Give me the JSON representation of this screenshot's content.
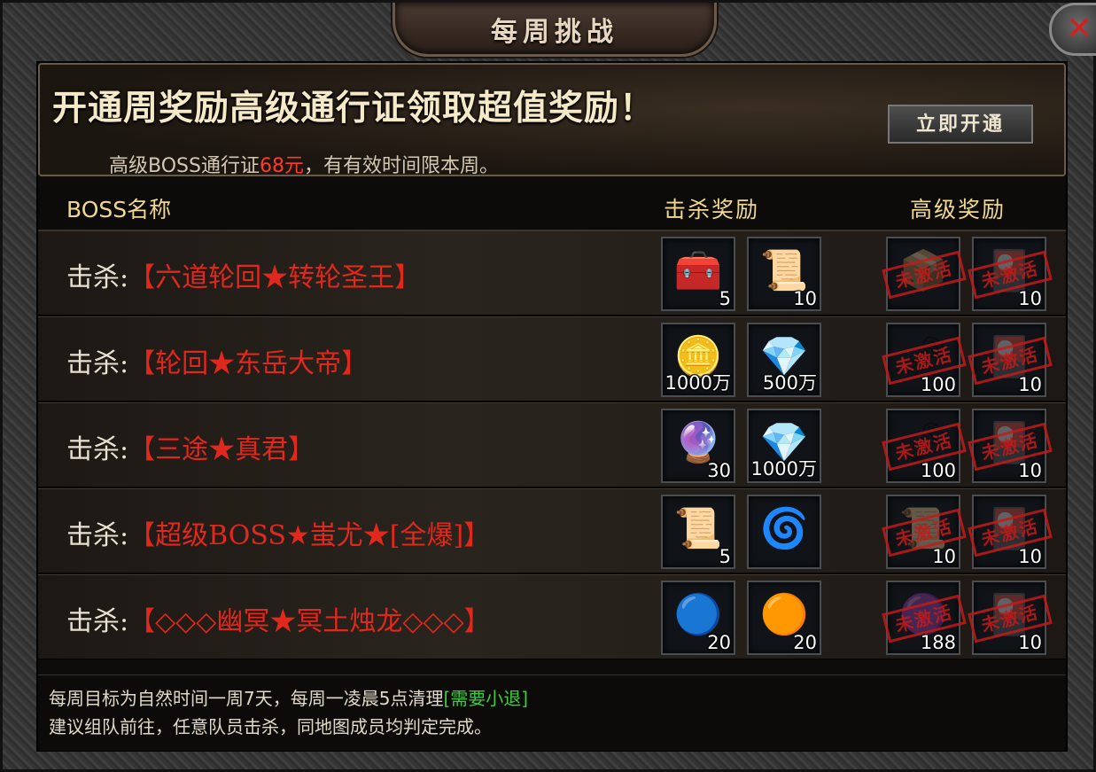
{
  "window": {
    "title": "每周挑战",
    "close_glyph": "✕"
  },
  "banner": {
    "title": "开通周奖励高级通行证领取超值奖励！",
    "sub_prefix": "高级BOSS通行证",
    "sub_price": "68元",
    "sub_suffix": "，有有效时间限本周。",
    "open_button": "立即开通"
  },
  "table": {
    "col_name": "BOSS名称",
    "col_kill": "击杀奖励",
    "col_advanced": "高级奖励",
    "kill_prefix": "击杀",
    "colon": ":",
    "locked_stamp": "未激活",
    "rows": [
      {
        "boss": "【六道轮回★转轮圣王】",
        "kill_rewards": [
          {
            "icon": "treasure-chest-icon",
            "glyph": "🧰",
            "count": "5"
          },
          {
            "icon": "scroll-map-icon",
            "glyph": "📜",
            "count": "10"
          }
        ],
        "adv_rewards": [
          {
            "icon": "golden-chest-icon",
            "glyph": "📦",
            "count": ""
          },
          {
            "icon": "red-item-icon",
            "glyph": "🎴",
            "count": "10"
          }
        ]
      },
      {
        "boss": "【轮回★东岳大帝】",
        "kill_rewards": [
          {
            "icon": "gold-ingot-icon",
            "glyph": "🪙",
            "count": "1000万"
          },
          {
            "icon": "gem-icon",
            "glyph": "💎",
            "count": "500万"
          }
        ],
        "adv_rewards": [
          {
            "icon": "dark-item-icon",
            "glyph": "🗝",
            "count": "100"
          },
          {
            "icon": "red-item-icon",
            "glyph": "🎴",
            "count": "10"
          }
        ]
      },
      {
        "boss": "【三途★真君】",
        "kill_rewards": [
          {
            "icon": "glowing-stone-icon",
            "glyph": "🔮",
            "count": "30"
          },
          {
            "icon": "gem-icon",
            "glyph": "💎",
            "count": "1000万"
          }
        ],
        "adv_rewards": [
          {
            "icon": "dark-item-icon",
            "glyph": "🗝",
            "count": "100"
          },
          {
            "icon": "red-item-icon",
            "glyph": "🎴",
            "count": "10"
          }
        ]
      },
      {
        "boss": "【超级BOSS★蚩尤★[全爆]】",
        "kill_rewards": [
          {
            "icon": "red-scroll-icon",
            "glyph": "📜",
            "count": "5"
          },
          {
            "icon": "blue-scroll-icon",
            "glyph": "🌀",
            "count": ""
          }
        ],
        "adv_rewards": [
          {
            "icon": "red-scroll-icon",
            "glyph": "📜",
            "count": "10"
          },
          {
            "icon": "red-item-icon",
            "glyph": "🎴",
            "count": "10"
          }
        ]
      },
      {
        "boss": "【◇◇◇幽冥★冥土烛龙◇◇◇】",
        "kill_rewards": [
          {
            "icon": "blue-orb-icon",
            "glyph": "🔵",
            "count": "20"
          },
          {
            "icon": "golden-ring-icon",
            "glyph": "🟠",
            "count": "20"
          }
        ],
        "adv_rewards": [
          {
            "icon": "dark-orb-icon",
            "glyph": "🟣",
            "count": "188"
          },
          {
            "icon": "red-item-icon",
            "glyph": "🎴",
            "count": "10"
          }
        ]
      }
    ]
  },
  "footer": {
    "line1": "每周目标为自然时间一周7天，每周一凌晨5点清理",
    "line1_note": "[需要小退]",
    "line2": "建议组队前往，任意队员击杀，同地图成员均判定完成。"
  },
  "colors": {
    "boss_name": "#e0281c",
    "price": "#ff3a2a",
    "note_green": "#3ccc3c",
    "header_gold": "#f0d890",
    "stamp_red": "#c41a1a"
  }
}
